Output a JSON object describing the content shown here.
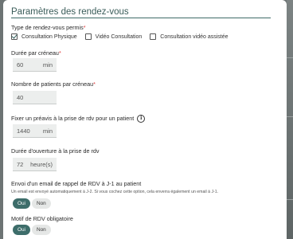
{
  "modal": {
    "title": "Paramètres des rendez-vous"
  },
  "appointment_types": {
    "label": "Type de rendez-vous permis",
    "required_mark": "*",
    "options": [
      {
        "label": "Consultation Physique",
        "checked": true
      },
      {
        "label": "Vidéo Consultation",
        "checked": false
      },
      {
        "label": "Consultation vidéo assistée",
        "checked": false
      }
    ]
  },
  "slot_duration": {
    "label": "Durée par créneau",
    "required_mark": "*",
    "value": "60",
    "unit": "min"
  },
  "patients_per_slot": {
    "label": "Nombre de patients par créneau",
    "required_mark": "*",
    "value": "40"
  },
  "notice": {
    "label": "Fixer un préavis à la prise de rdv pour un patient",
    "info_icon": "info-icon",
    "value": "1440",
    "unit": "min"
  },
  "opening_duration": {
    "label": "Durée d'ouverture à la prise de rdv",
    "value": "72",
    "unit": "heure(s)"
  },
  "reminder_email": {
    "label": "Envoi d'un email de rappel de RDV à J-1 au patient",
    "hint": "Un email est envoyé automatiquement à J-2. Si vous cochez cette option, cela enverra également un email à J-1.",
    "yes": "Oui",
    "no": "Non",
    "selected": "Oui"
  },
  "mandatory_reason": {
    "label": "Motif de RDV obligatoire",
    "yes": "Oui",
    "no": "Non",
    "selected": "Oui"
  },
  "colors": {
    "accent": "#3d6d6a",
    "required": "#e03a3a",
    "backdrop": "#6d7474"
  }
}
